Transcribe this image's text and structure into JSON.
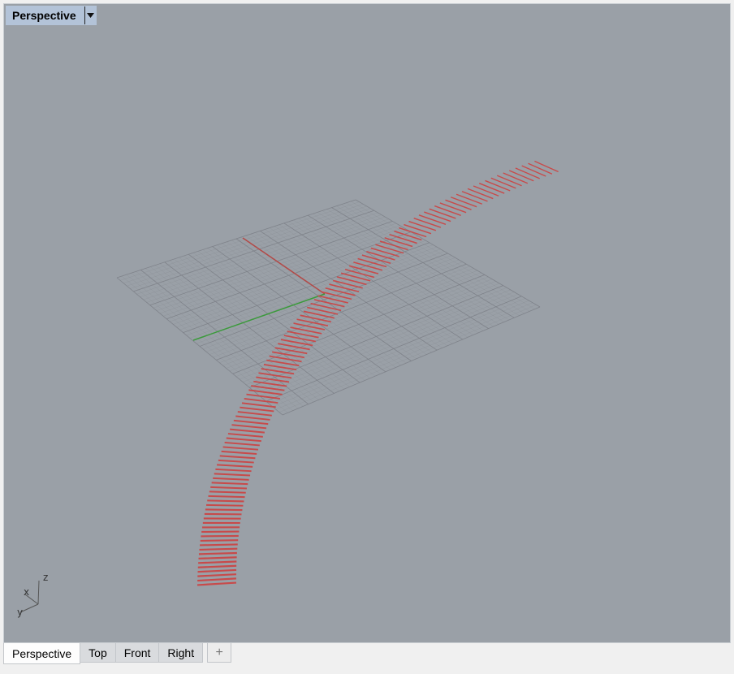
{
  "viewport": {
    "title": "Perspective",
    "dropdown_icon": "triangle-down-icon",
    "background_color": "#9aa0a7",
    "grid_color": "#7c8087",
    "x_axis_color": "#b34a48",
    "y_axis_color": "#3b9a3b",
    "curve_color": "#c84a4a",
    "axes_widget": {
      "x": "x",
      "y": "y",
      "z": "z"
    }
  },
  "tabs": [
    {
      "label": "Perspective",
      "active": true
    },
    {
      "label": "Top",
      "active": false
    },
    {
      "label": "Front",
      "active": false
    },
    {
      "label": "Right",
      "active": false
    }
  ],
  "add_tab": {
    "icon": "plus-icon",
    "glyph": "+"
  }
}
